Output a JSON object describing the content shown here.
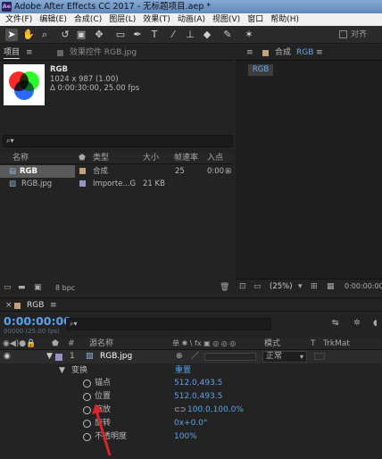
{
  "window": {
    "title": "Adobe After Effects CC 2017 - 无标题项目.aep *",
    "logo_text": "Ae"
  },
  "menu": [
    "文件(F)",
    "编辑(E)",
    "合成(C)",
    "图层(L)",
    "效果(T)",
    "动画(A)",
    "视图(V)",
    "窗口",
    "帮助(H)"
  ],
  "toolbar": {
    "align_label": "对齐"
  },
  "project_panel": {
    "tab_project": "项目",
    "tab_menu": "≡",
    "tab_effects": "效果控件 RGB.jpg",
    "item_name": "RGB",
    "item_size": "1024 x 987 (1.00)",
    "item_duration": "Δ 0:00:30:00, 25.00 fps",
    "search_icon": "⌕▾",
    "columns": [
      "名称",
      "类型",
      "大小",
      "帧速率",
      "入点"
    ],
    "rows": [
      {
        "name": "RGB",
        "type": "合成",
        "size": "",
        "fps": "25",
        "in": "0:00",
        "swatch": "#c2a27d"
      },
      {
        "name": "RGB.jpg",
        "type": "Importe...G",
        "size": "21 KB",
        "fps": "",
        "in": "",
        "swatch": "#9c8fc7"
      }
    ],
    "bpc": "8 bpc"
  },
  "viewer": {
    "tab_menu": "≡",
    "tab_title": "合成",
    "tab_comp": "RGB",
    "comp_chip": "RGB",
    "zoom": "(25%)",
    "timecode": "0:00:00:00"
  },
  "timeline": {
    "tab_close": "×",
    "tab_label": "RGB",
    "tab_menu": "≡",
    "timecode": "0:00:00:00",
    "fps": "00000 (25.00 fps)",
    "col_hash": "#",
    "col_source": "源名称",
    "col_switches": "单 ✱ \\ fx ▣ ◎ ◎ ◎",
    "col_mode": "模式",
    "col_t": "T",
    "col_trkmat": "TrkMat",
    "layer": {
      "index": "1",
      "name": "RGB.jpg",
      "mode": "正常"
    },
    "transform_label": "变换",
    "reset_label": "重置",
    "props": [
      {
        "label": "锚点",
        "value": "512.0,493.5"
      },
      {
        "label": "位置",
        "value": "512.0,493.5"
      },
      {
        "label": "缩放",
        "value": "100.0,100.0%"
      },
      {
        "label": "旋转",
        "value": "0x+0.0°"
      },
      {
        "label": "不透明度",
        "value": "100%"
      }
    ]
  },
  "colors": {
    "accent": "#5aa2ee",
    "titlebar": "#6b93c2",
    "arrow": "#d8232a"
  }
}
